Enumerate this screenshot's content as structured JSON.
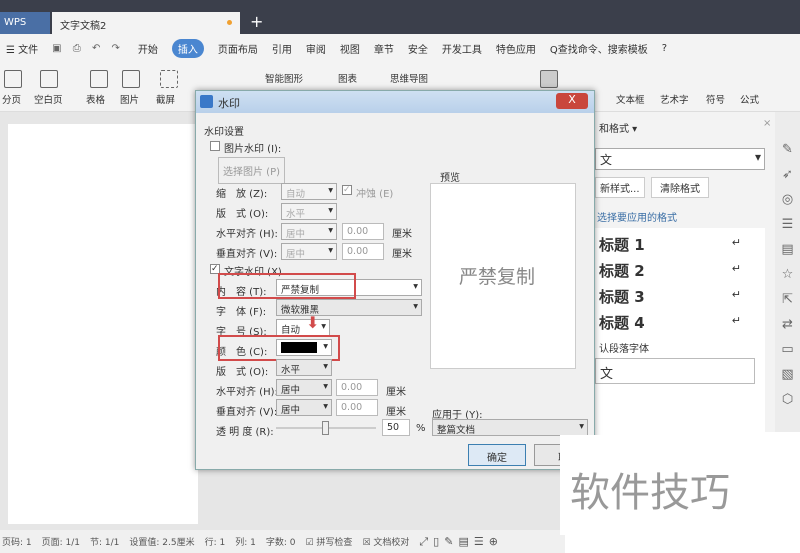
{
  "titlebar": {
    "app": "WPS",
    "doc_tab": "文字文稿2",
    "new_tab": "+"
  },
  "menu": {
    "file": "☰ 文件",
    "items": [
      "开始",
      "插入",
      "页面布局",
      "引用",
      "审阅",
      "视图",
      "章节",
      "安全",
      "开发工具",
      "特色应用"
    ],
    "active_index": 1,
    "search": "Q查找命令、搜索模板",
    "help": "?"
  },
  "ribbon": [
    "分页",
    "空白页",
    "表格",
    "图片",
    "截屏",
    "智能图形",
    "图表",
    "思维导图",
    "文本框",
    "艺术字",
    "符号",
    "公式"
  ],
  "dialog": {
    "title": "水印",
    "close": "X",
    "group": "水印设置",
    "pic_wm": {
      "label": "图片水印 (I):",
      "checked": false,
      "choose": "选择图片 (P)",
      "scale_label": "缩　放 (Z):",
      "scale": "自动",
      "washout": "冲蚀 (E)",
      "layout_label": "版　式 (O):",
      "layout": "水平",
      "h_label": "水平对齐 (H):",
      "h": "居中",
      "h_val": "0.00",
      "v_label": "垂直对齐 (V):",
      "v": "居中",
      "v_val": "0.00",
      "unit": "厘米"
    },
    "text_wm": {
      "label": "文字水印 (X)",
      "checked": true,
      "content_label": "内　容 (T):",
      "content": "严禁复制",
      "font_label": "字　体 (F):",
      "font": "微软雅黑",
      "size_label": "字　号 (S):",
      "size": "自动",
      "color_label": "颜　色 (C):",
      "color": "#000000",
      "layout_label": "版　式 (O):",
      "layout": "水平",
      "h_label": "水平对齐 (H):",
      "h": "居中",
      "h_val": "0.00",
      "v_label": "垂直对齐 (V):",
      "v": "居中",
      "v_val": "0.00",
      "unit": "厘米",
      "trans_label": "透 明 度 (R):",
      "trans": "50",
      "pct": "%"
    },
    "preview_label": "预览",
    "preview_text": "严禁复制",
    "apply_label": "应用于 (Y):",
    "apply": "整篇文档",
    "ok": "确定",
    "cancel": "取"
  },
  "panel": {
    "title": "和格式 ▾",
    "current": "文",
    "new_style": "新样式...",
    "clear": "清除格式",
    "hint": "选择要应用的格式",
    "styles": [
      "标题 1",
      "标题 2",
      "标题 3",
      "标题 4"
    ],
    "default_font": "认段落字体",
    "body": "文"
  },
  "status": [
    "页码: 1",
    "页面: 1/1",
    "节: 1/1",
    "设置值: 2.5厘米",
    "行: 1",
    "列: 1",
    "字数: 0",
    "☑ 拼写检查",
    "☒ 文档校对"
  ],
  "watermark_overlay": "软件技巧"
}
